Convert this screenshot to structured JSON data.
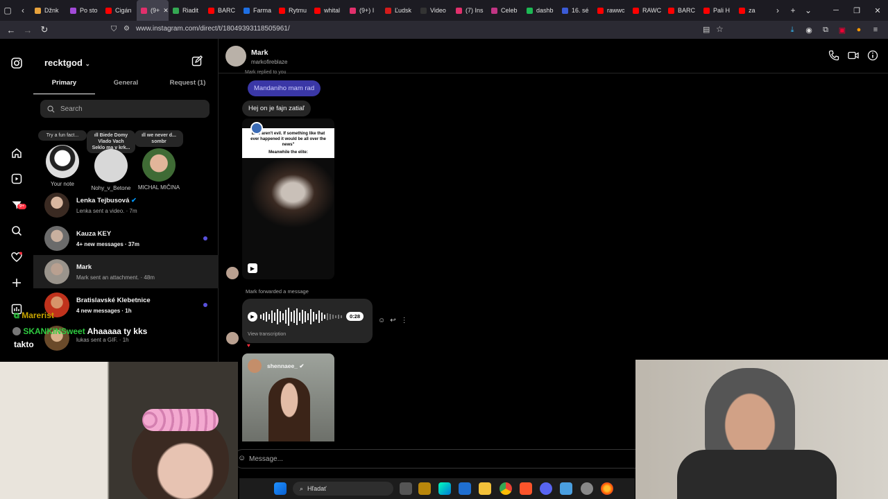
{
  "browser": {
    "tabs": [
      {
        "label": "Džnk",
        "color": "#e8a23c"
      },
      {
        "label": "Po sto",
        "color": "#a24ad8"
      },
      {
        "label": "Cigán",
        "color": "#ff0000"
      },
      {
        "label": "(9+",
        "color": "#e1306c"
      },
      {
        "label": "Riadit",
        "color": "#34a853"
      },
      {
        "label": "BARC",
        "color": "#ff0000"
      },
      {
        "label": "Farma",
        "color": "#1e6fe3"
      },
      {
        "label": "Rytmu",
        "color": "#ff0000"
      },
      {
        "label": "whital",
        "color": "#ff0000"
      },
      {
        "label": "(9+) I",
        "color": "#e1306c"
      },
      {
        "label": "Ľudsk",
        "color": "#d41b1b"
      },
      {
        "label": "Video",
        "color": "#333333"
      },
      {
        "label": "(7) Ins",
        "color": "#e1306c"
      },
      {
        "label": "Celeb",
        "color": "#c13584"
      },
      {
        "label": "dashb",
        "color": "#1db954"
      },
      {
        "label": "16. sé",
        "color": "#3b5bd6"
      },
      {
        "label": "rawwc",
        "color": "#ff0000"
      },
      {
        "label": "RAWC",
        "color": "#ff0000"
      },
      {
        "label": "BARC",
        "color": "#ff0000"
      },
      {
        "label": "Pali H",
        "color": "#ff0000"
      },
      {
        "label": "za",
        "color": "#ff0000"
      }
    ],
    "url": "www.instagram.com/direct/t/18049393118505961/"
  },
  "inbox": {
    "username": "recktgod",
    "tabs": [
      "Primary",
      "General",
      "Request (1)"
    ],
    "search_placeholder": "Search",
    "notes": [
      {
        "bubble": "Try a fun fact...",
        "name": "Your note"
      },
      {
        "bubble": "ıll Biede Domy\nVlado Vach\nSeklo ma v krk...",
        "name": "Nohy_v_Betone"
      },
      {
        "bubble": "ıll we never d...\nsombr",
        "name": "MICHAL MIČINA"
      }
    ],
    "conversations": [
      {
        "name": "Lenka Tejbusová",
        "sub": "Lenka sent a video. · 7m",
        "verified": true,
        "unread": false
      },
      {
        "name": "Kauza KEY",
        "sub": "4+ new messages · 37m",
        "unread": true
      },
      {
        "name": "Mark",
        "sub": "Mark sent an attachment. · 48m",
        "unread": false,
        "selected": true
      },
      {
        "name": "Bratislavské Klebetnice",
        "sub": "4 new messages · 1h",
        "unread": true
      },
      {
        "name": "",
        "sub": "lukas sent a GIF. · 1h",
        "unread": false
      }
    ]
  },
  "chat": {
    "name": "Mark",
    "handle": "markofireblaze",
    "replied_to": "Mark replied to you",
    "own_msg": "Mandaniho mam rad",
    "their_msg": "Hej on je fajn zatiaľ",
    "meme_top": "Elite aren't evil. If something like that ever happened it would be all over the news\"",
    "meme_bottom": "Meanwhile the elite:",
    "forwarded": "Mark forwarded a message",
    "voice_duration": "0:28",
    "transcription": "View transcription",
    "reel_user": "shennaee_",
    "composer_placeholder": "Message..."
  },
  "overlay_chat": [
    {
      "user": "Marerist",
      "text": "",
      "color": "#c8a400"
    },
    {
      "user": "SKANKINSweet",
      "text": "Ahaaaaa ty kks",
      "color": "#2ecc40"
    },
    {
      "user": "",
      "text": "takto",
      "color": "#ffffff"
    }
  ],
  "taskbar": {
    "search_label": "Hľadať"
  }
}
